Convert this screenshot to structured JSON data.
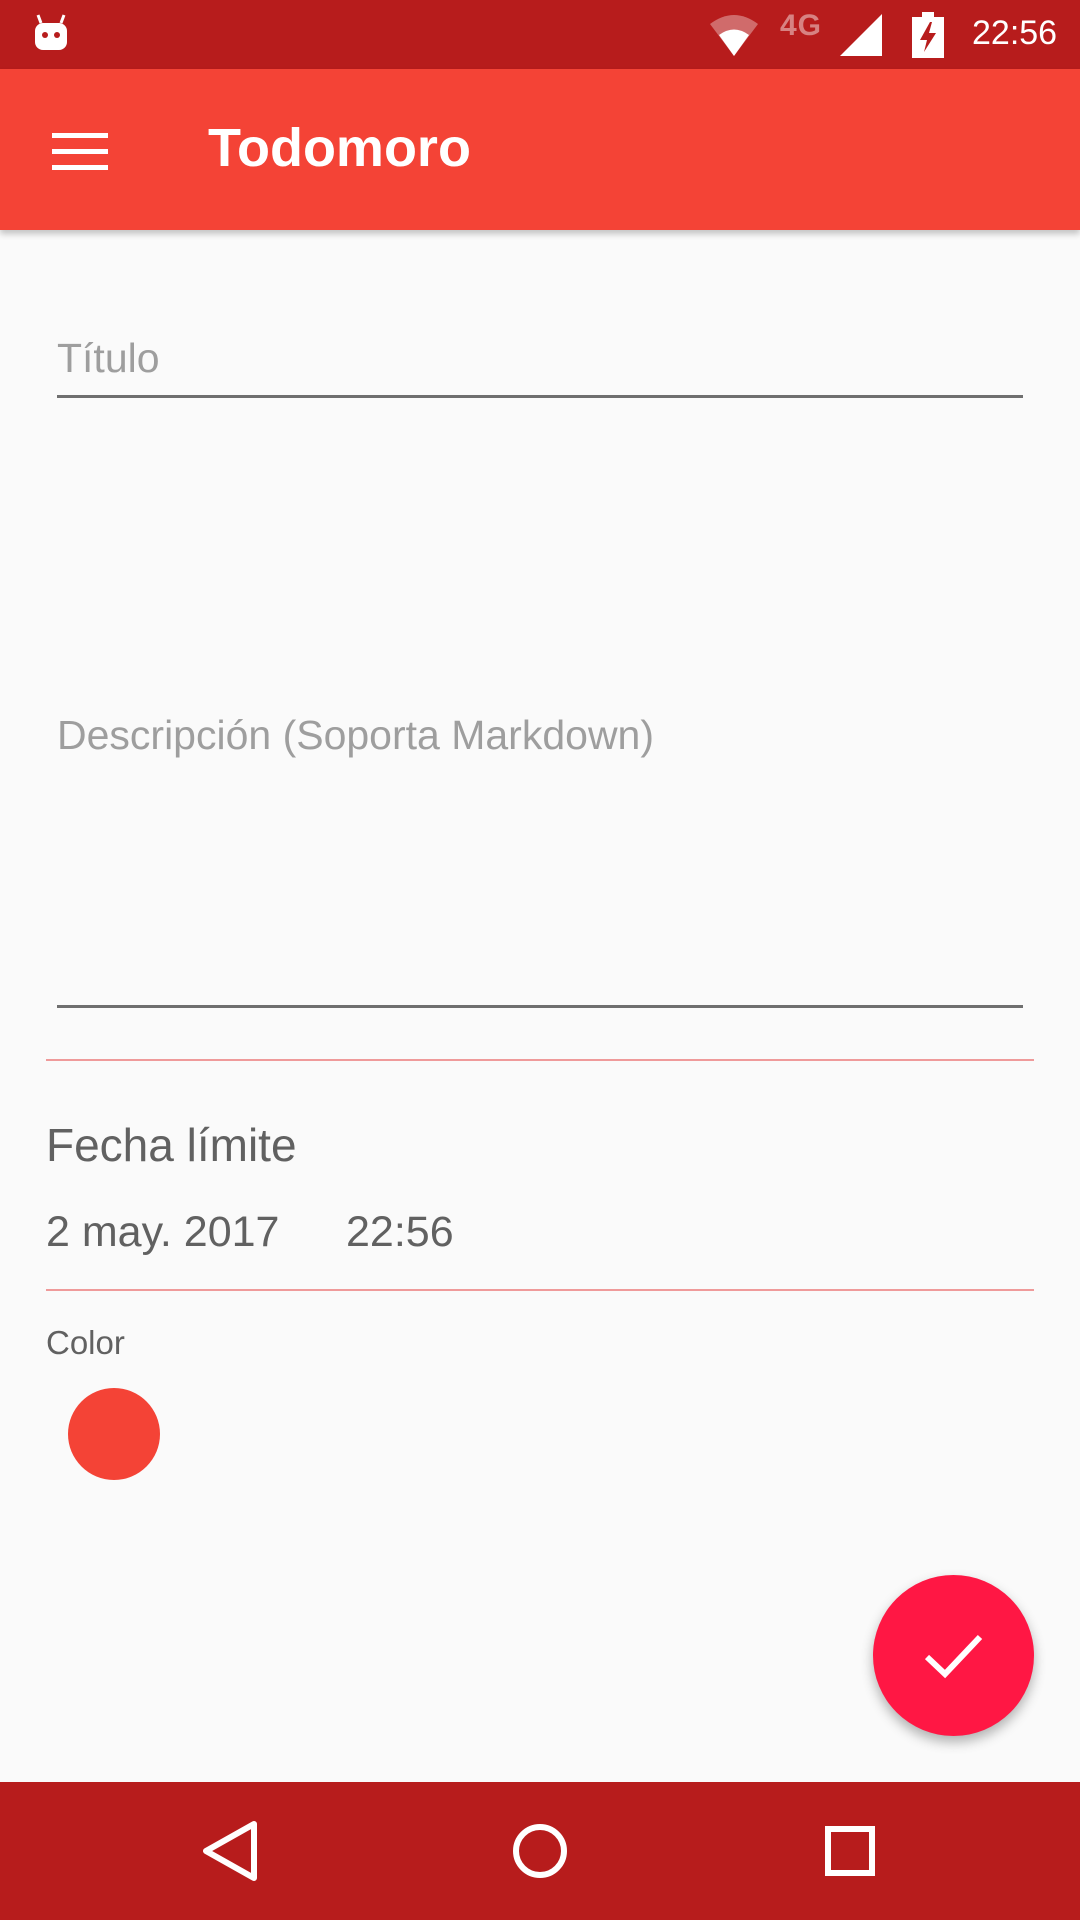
{
  "status_bar": {
    "time": "22:56",
    "network": "4G",
    "icons": [
      "android-notification-icon",
      "wifi-icon",
      "signal-icon",
      "battery-charging-icon"
    ]
  },
  "app_bar": {
    "title": "Todomoro",
    "menu_icon": "hamburger-menu-icon"
  },
  "form": {
    "title_placeholder": "Título",
    "title_value": "",
    "description_placeholder": "Descripción (Soporta Markdown)",
    "description_value": ""
  },
  "deadline": {
    "label": "Fecha límite",
    "date": "2 may. 2017",
    "time": "22:56"
  },
  "color": {
    "label": "Color",
    "selected": "#f44336"
  },
  "fab": {
    "icon": "check-icon",
    "color": "#ff1744"
  },
  "nav_bar": {
    "buttons": [
      "back-icon",
      "home-icon",
      "recents-icon"
    ]
  },
  "theme": {
    "primary": "#f44336",
    "primary_dark": "#b71c1c",
    "accent": "#ff1744",
    "divider": "#ef9a9a"
  }
}
